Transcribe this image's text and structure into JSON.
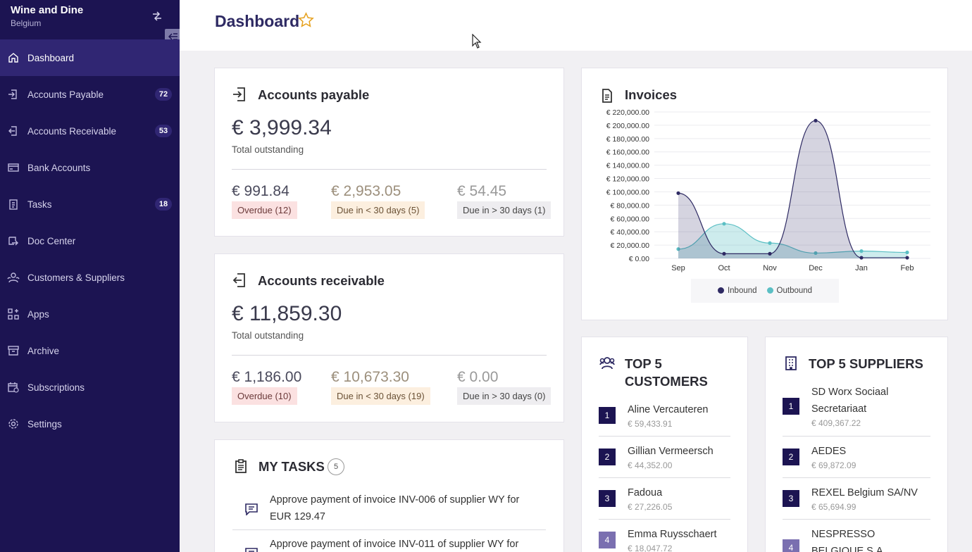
{
  "sidebar": {
    "brand": "Wine and Dine",
    "country": "Belgium",
    "items": [
      {
        "label": "Dashboard",
        "icon": "home-icon",
        "badge": ""
      },
      {
        "label": "Accounts Payable",
        "icon": "payable-icon",
        "badge": "72"
      },
      {
        "label": "Accounts Receivable",
        "icon": "receivable-icon",
        "badge": "53"
      },
      {
        "label": "Bank Accounts",
        "icon": "card-icon",
        "badge": ""
      },
      {
        "label": "Tasks",
        "icon": "clipboard-icon",
        "badge": "18"
      },
      {
        "label": "Doc Center",
        "icon": "doc-center-icon",
        "badge": ""
      },
      {
        "label": "Customers & Suppliers",
        "icon": "users-icon",
        "badge": ""
      },
      {
        "label": "Apps",
        "icon": "apps-icon",
        "badge": ""
      },
      {
        "label": "Archive",
        "icon": "archive-icon",
        "badge": ""
      },
      {
        "label": "Subscriptions",
        "icon": "calendar-icon",
        "badge": ""
      },
      {
        "label": "Settings",
        "icon": "gear-icon",
        "badge": ""
      }
    ]
  },
  "header": {
    "title": "Dashboard"
  },
  "payable": {
    "title": "Accounts payable",
    "total": "€ 3,999.34",
    "total_label": "Total outstanding",
    "overdue_amount": "€ 991.84",
    "overdue_label": "Overdue (12)",
    "due_soon_amount": "€ 2,953.05",
    "due_soon_label": "Due in < 30 days (5)",
    "due_later_amount": "€ 54.45",
    "due_later_label": "Due in > 30 days (1)"
  },
  "receivable": {
    "title": "Accounts receivable",
    "total": "€ 11,859.30",
    "total_label": "Total outstanding",
    "overdue_amount": "€ 1,186.00",
    "overdue_label": "Overdue (10)",
    "due_soon_amount": "€ 10,673.30",
    "due_soon_label": "Due in < 30 days (19)",
    "due_later_amount": "€ 0.00",
    "due_later_label": "Due in > 30 days (0)"
  },
  "tasks": {
    "title": "MY TASKS",
    "count": "5",
    "items": [
      "Approve payment of invoice INV-006 of supplier WY for EUR 129.47",
      "Approve payment of invoice INV-011 of supplier WY for"
    ]
  },
  "invoices": {
    "title": "Invoices"
  },
  "chart_data": {
    "type": "area",
    "title": "Invoices",
    "categories": [
      "Sep",
      "Oct",
      "Nov",
      "Dec",
      "Jan",
      "Feb"
    ],
    "ylim": [
      0,
      220000
    ],
    "y_ticks": [
      "€ 220,000.00",
      "€ 200,000.00",
      "€ 180,000.00",
      "€ 160,000.00",
      "€ 140,000.00",
      "€ 120,000.00",
      "€ 100,000.00",
      "€ 80,000.00",
      "€ 60,000.00",
      "€ 40,000.00",
      "€ 20,000.00",
      "€ 0.00"
    ],
    "series": [
      {
        "name": "Inbound",
        "color": "#2e2a63",
        "values": [
          98000,
          7000,
          7000,
          207000,
          1000,
          1000
        ]
      },
      {
        "name": "Outbound",
        "color": "#5bbfc4",
        "values": [
          14000,
          52000,
          23000,
          8000,
          11000,
          9000
        ]
      }
    ],
    "legend": "bottom",
    "grid": true
  },
  "customers": {
    "title_line1": "TOP 5",
    "title_line2": "CUSTOMERS",
    "items": [
      {
        "rank": "1",
        "name": "Aline Vercauteren",
        "value": "€ 59,433.91"
      },
      {
        "rank": "2",
        "name": "Gillian Vermeersch",
        "value": "€ 44,352.00"
      },
      {
        "rank": "3",
        "name": "Fadoua",
        "value": "€ 27,226.05"
      },
      {
        "rank": "4",
        "name": "Emma Ruysschaert",
        "value": "€ 18,047.72"
      }
    ]
  },
  "suppliers": {
    "title": "TOP 5 SUPPLIERS",
    "items": [
      {
        "rank": "1",
        "name": "SD Worx Sociaal Secretariaat",
        "value": "€ 409,367.22"
      },
      {
        "rank": "2",
        "name": "AEDES",
        "value": "€ 69,872.09"
      },
      {
        "rank": "3",
        "name": "REXEL Belgium SA/NV",
        "value": "€ 65,694.99"
      },
      {
        "rank": "4",
        "name": "NESPRESSO BELGIQUE S.A.",
        "value": ""
      }
    ]
  }
}
